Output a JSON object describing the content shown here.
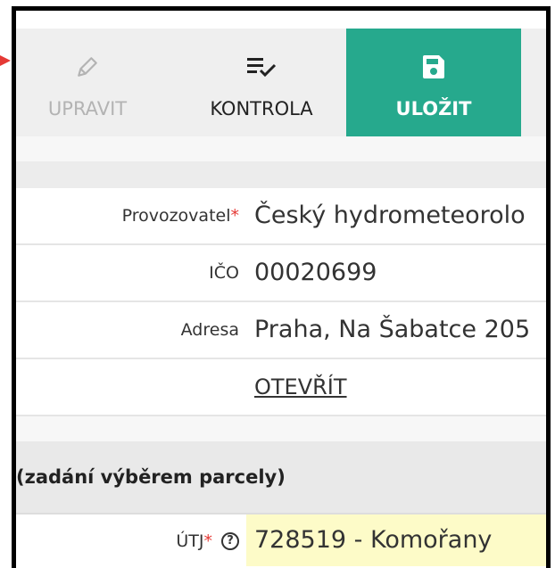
{
  "toolbar": {
    "upravit_label": "UPRAVIT",
    "kontrola_label": "KONTROLA",
    "ulozit_label": "ULOŽIT",
    "icons": {
      "upravit": "pencil-icon",
      "kontrola": "checklist-icon",
      "ulozit": "save-icon"
    },
    "colors": {
      "save_bg": "#26a98d",
      "disabled_text": "#b3b3b3"
    }
  },
  "form": {
    "provozovatel": {
      "label": "Provozovatel",
      "required_mark": "*",
      "value": "Český hydrometeorolo"
    },
    "ico": {
      "label": "IČO",
      "value": "00020699"
    },
    "adresa": {
      "label": "Adresa",
      "value": "Praha, Na Šabatce 205"
    },
    "open_link": "OTEVŘÍT"
  },
  "section": {
    "title": "(zadání výběrem parcely)"
  },
  "utj": {
    "label": "ÚTJ",
    "required_mark": "*",
    "help_icon": "help-circle-icon",
    "value": "728519 - Komořany"
  },
  "annotation": {
    "arrow_color": "#e53935"
  }
}
